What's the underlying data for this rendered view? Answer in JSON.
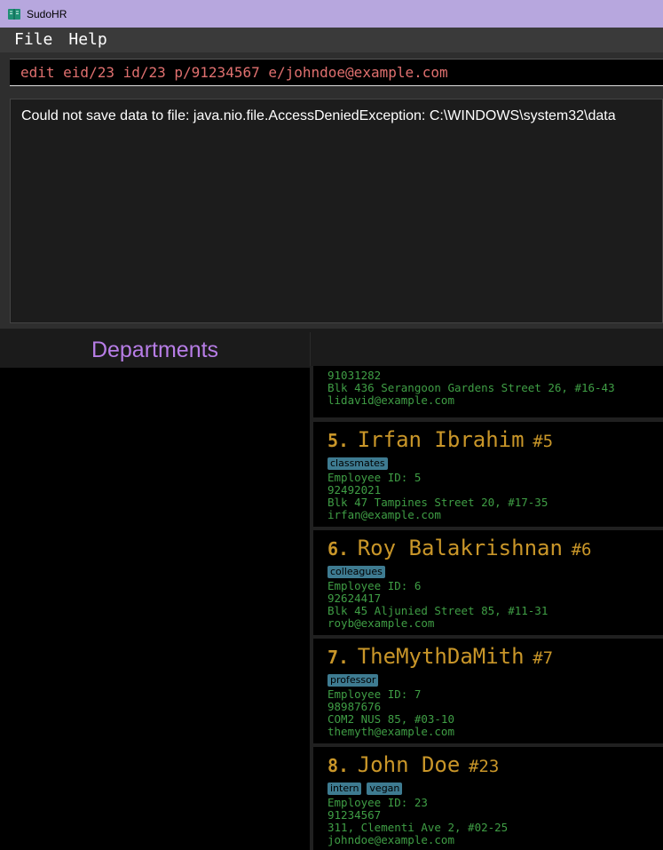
{
  "window": {
    "title": "SudoHR",
    "icon": "book-icon"
  },
  "menu": {
    "file": "File",
    "help": "Help"
  },
  "command": {
    "value": "edit eid/23 id/23 p/91234567 e/johndoe@example.com"
  },
  "result": {
    "message": "Could not save data to file: java.nio.file.AccessDeniedException: C:\\WINDOWS\\system32\\data"
  },
  "departments": {
    "header": "Departments"
  },
  "employees": {
    "partial": {
      "phone": "91031282",
      "address": "Blk 436 Serangoon Gardens Street 26, #16-43",
      "email": "lidavid@example.com"
    },
    "cards": [
      {
        "index": "5.",
        "name": "Irfan Ibrahim",
        "id_badge": "#5",
        "tags": [
          "classmates"
        ],
        "employee_id": "Employee ID: 5",
        "phone": "92492021",
        "address": "Blk 47 Tampines Street 20, #17-35",
        "email": "irfan@example.com"
      },
      {
        "index": "6.",
        "name": "Roy Balakrishnan",
        "id_badge": "#6",
        "tags": [
          "colleagues"
        ],
        "employee_id": "Employee ID: 6",
        "phone": "92624417",
        "address": "Blk 45 Aljunied Street 85, #11-31",
        "email": "royb@example.com"
      },
      {
        "index": "7.",
        "name": "TheMythDaMith",
        "id_badge": "#7",
        "tags": [
          "professor"
        ],
        "employee_id": "Employee ID: 7",
        "phone": "98987676",
        "address": "COM2 NUS 85, #03-10",
        "email": "themyth@example.com"
      },
      {
        "index": "8.",
        "name": "John Doe",
        "id_badge": "#23",
        "tags": [
          "intern",
          "vegan"
        ],
        "employee_id": "Employee ID: 23",
        "phone": "91234567",
        "address": "311, Clementi Ave 2, #02-25",
        "email": "johndoe@example.com"
      }
    ]
  },
  "colors": {
    "titlebar": "#b7a7de",
    "department_header": "#b77de6",
    "name": "#c99629",
    "info_text": "#3f9e45",
    "tag_bg": "#3e7b91",
    "command_text": "#e0706f"
  }
}
